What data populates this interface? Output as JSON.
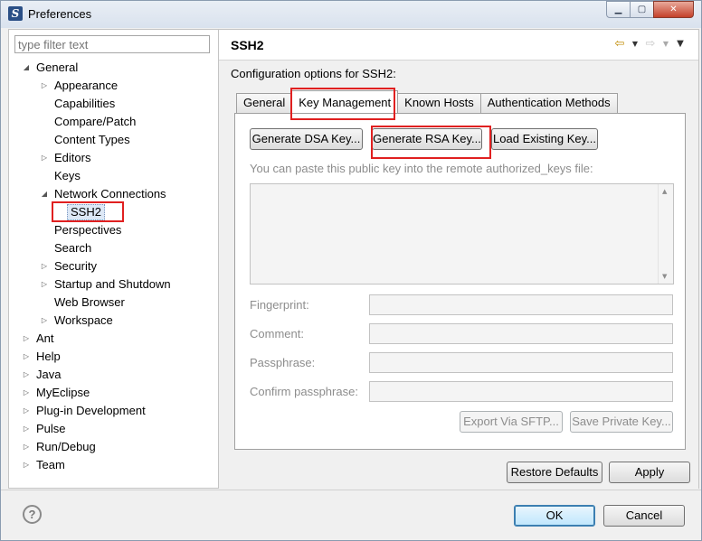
{
  "window": {
    "title": "Preferences",
    "app_icon_letter": "S",
    "minimize_glyph": "▁",
    "maximize_glyph": "▢",
    "close_glyph": "✕"
  },
  "sidebar": {
    "filter_placeholder": "type filter text",
    "tree": [
      {
        "label": "General",
        "expander": "◢",
        "expanded": true
      },
      {
        "label": "Appearance",
        "expander": "▷"
      },
      {
        "label": "Capabilities"
      },
      {
        "label": "Compare/Patch"
      },
      {
        "label": "Content Types"
      },
      {
        "label": "Editors",
        "expander": "▷"
      },
      {
        "label": "Keys"
      },
      {
        "label": "Network Connections",
        "expander": "◢",
        "expanded": true
      },
      {
        "label": "SSH2",
        "selected": true
      },
      {
        "label": "Perspectives"
      },
      {
        "label": "Search"
      },
      {
        "label": "Security",
        "expander": "▷"
      },
      {
        "label": "Startup and Shutdown",
        "expander": "▷"
      },
      {
        "label": "Web Browser"
      },
      {
        "label": "Workspace",
        "expander": "▷"
      },
      {
        "label": "Ant",
        "expander": "▷"
      },
      {
        "label": "Help",
        "expander": "▷"
      },
      {
        "label": "Java",
        "expander": "▷"
      },
      {
        "label": "MyEclipse",
        "expander": "▷"
      },
      {
        "label": "Plug-in Development",
        "expander": "▷"
      },
      {
        "label": "Pulse",
        "expander": "▷"
      },
      {
        "label": "Run/Debug",
        "expander": "▷"
      },
      {
        "label": "Team",
        "expander": "▷"
      }
    ]
  },
  "page": {
    "title": "SSH2",
    "description": "Configuration options for SSH2:",
    "nav": {
      "back": "⇦",
      "back_menu": "▼",
      "forward": "⇨",
      "forward_menu": "▼",
      "view_menu": "▼"
    },
    "tabs": [
      "General",
      "Key Management",
      "Known Hosts",
      "Authentication Methods"
    ],
    "active_tab": "Key Management",
    "key_management": {
      "generate_dsa": "Generate DSA Key...",
      "generate_rsa": "Generate RSA Key...",
      "load_existing": "Load Existing Key...",
      "hint": "You can paste this public key into the remote authorized_keys file:",
      "scroll_up": "▲",
      "scroll_down": "▼",
      "fingerprint_label": "Fingerprint:",
      "comment_label": "Comment:",
      "passphrase_label": "Passphrase:",
      "confirm_label": "Confirm passphrase:",
      "export_sftp": "Export Via SFTP...",
      "save_private": "Save Private Key..."
    },
    "restore_defaults": "Restore Defaults",
    "apply": "Apply"
  },
  "footer": {
    "help_glyph": "?",
    "ok": "OK",
    "cancel": "Cancel"
  },
  "colors": {
    "highlight_box": "#e02020",
    "selection": "#dde8f6",
    "disabled_text": "#8d8d8d"
  }
}
